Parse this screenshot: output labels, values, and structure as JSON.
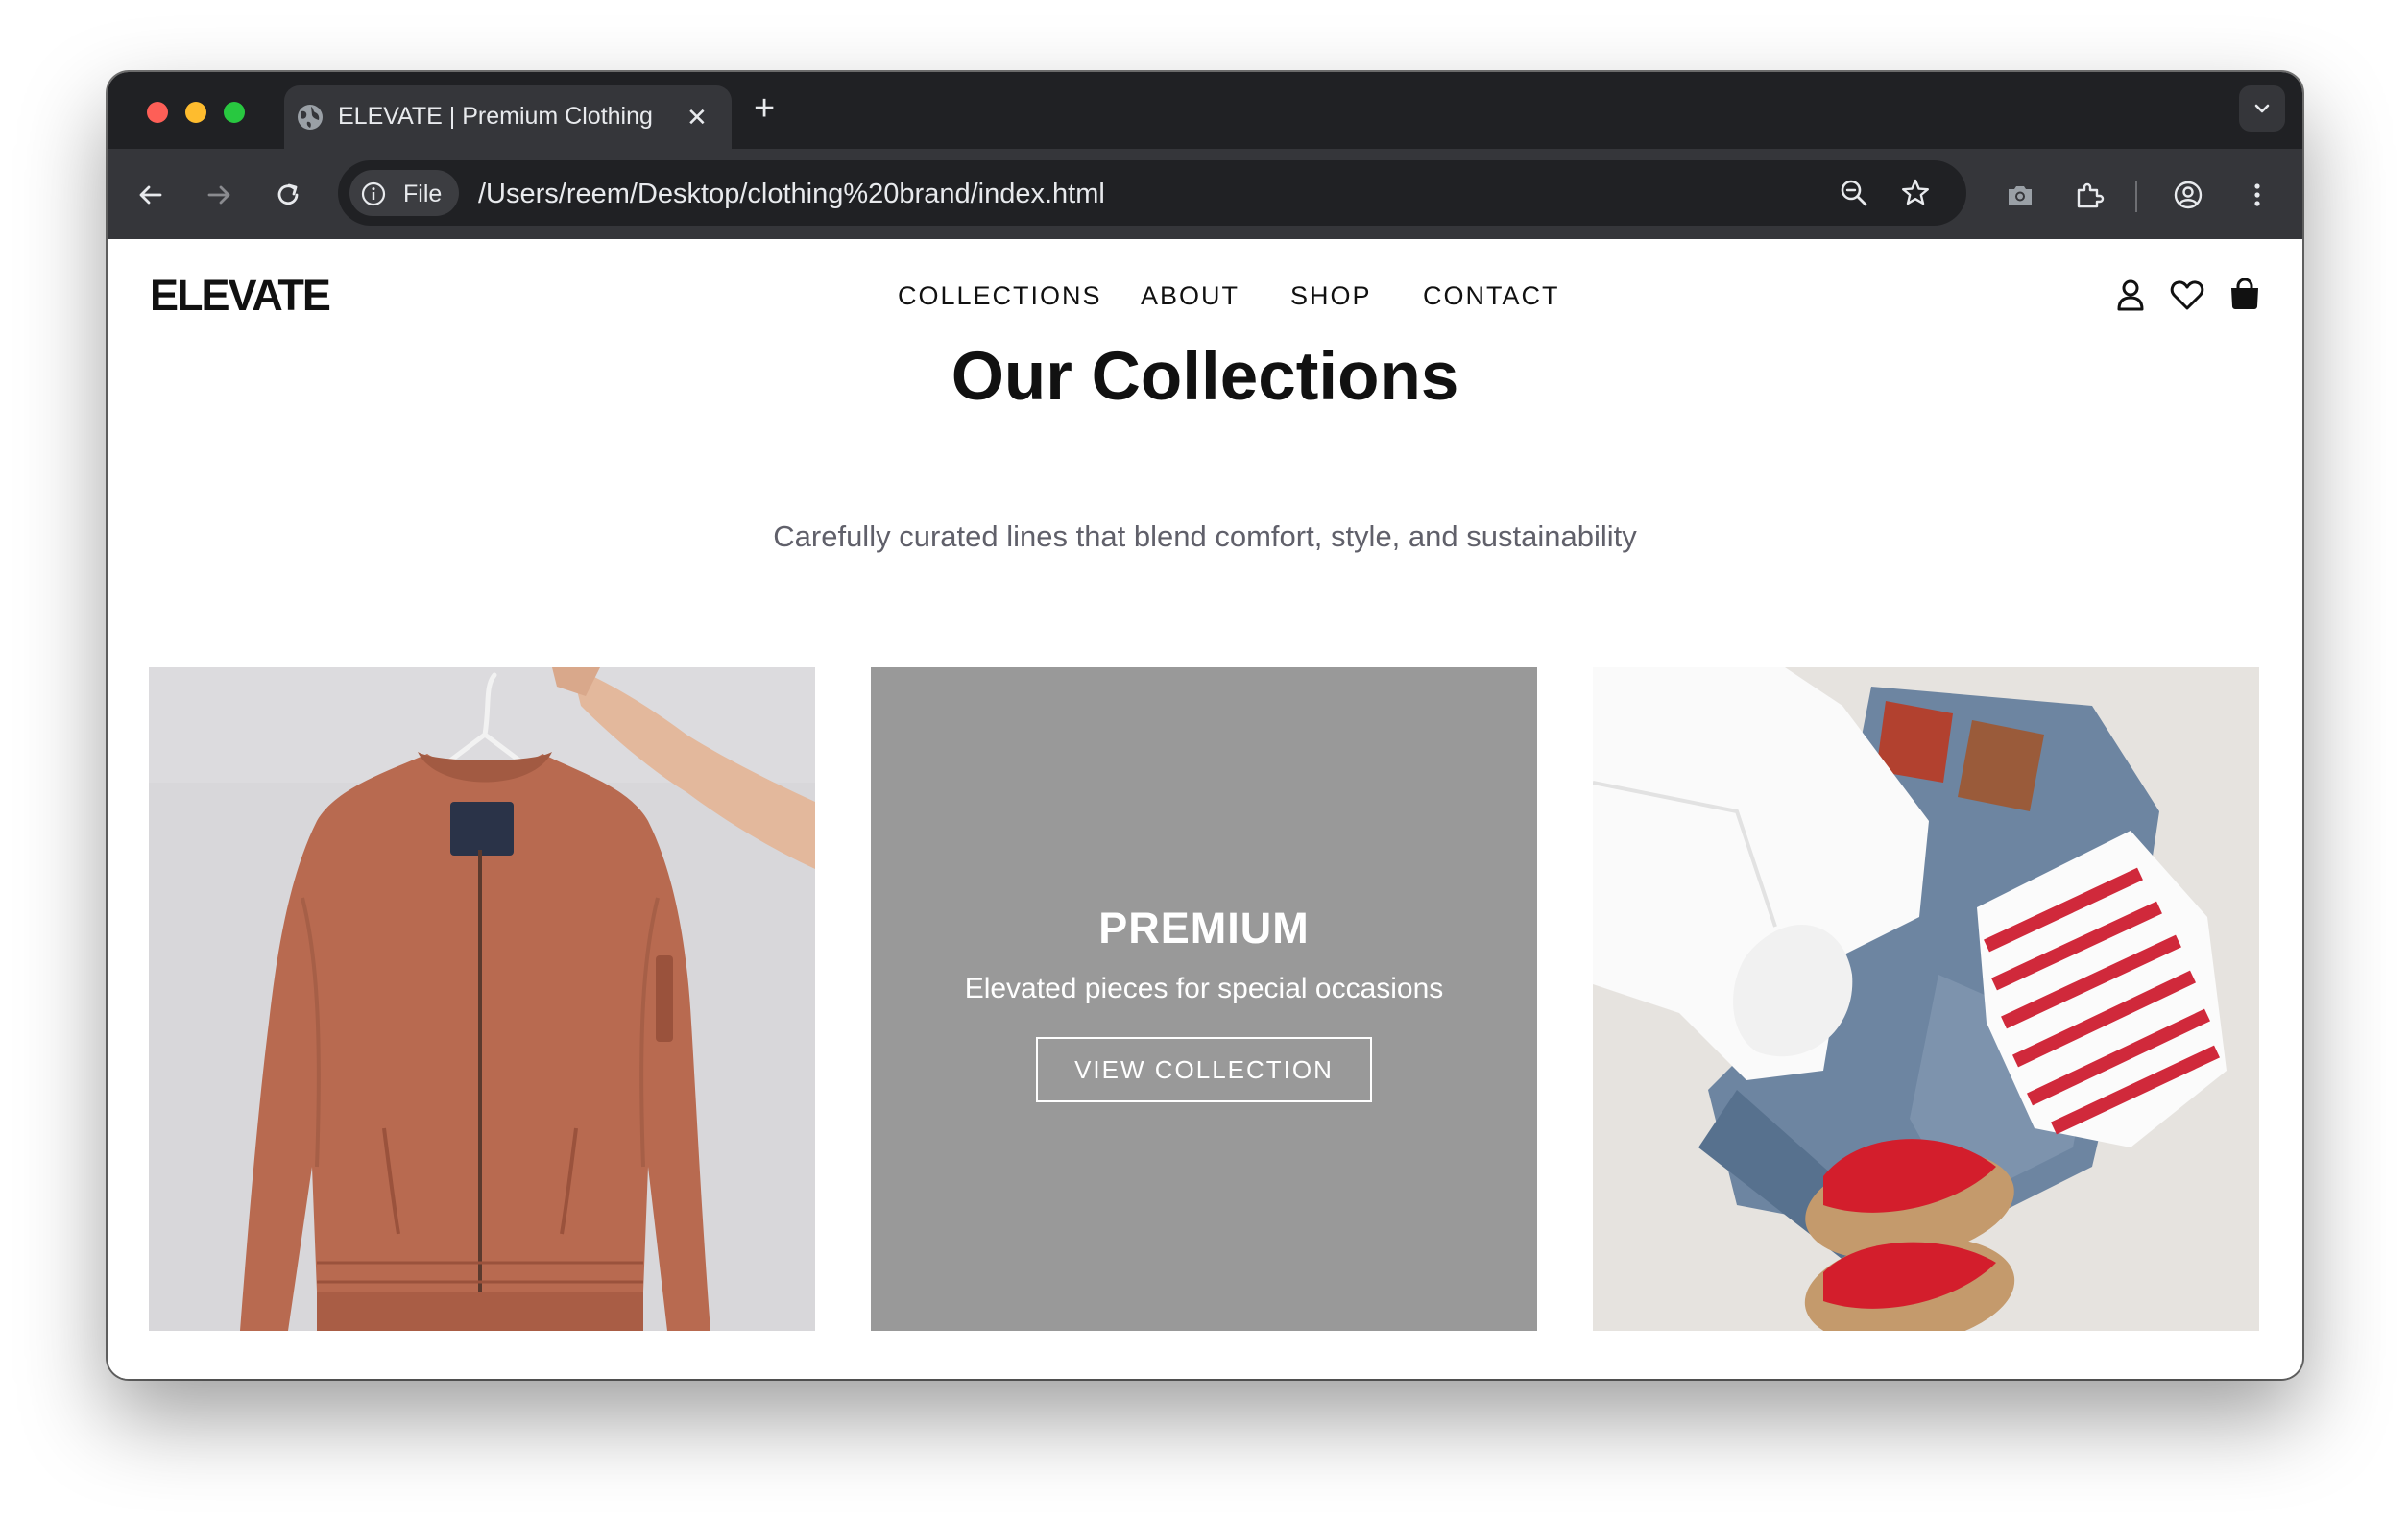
{
  "browser": {
    "tab_title": "ELEVATE | Premium Clothing",
    "tab_close": "✕",
    "new_tab": "+",
    "site_chip": "File",
    "url": "/Users/reem/Desktop/clothing%20brand/index.html",
    "icons": [
      "back-icon",
      "forward-icon",
      "reload-icon",
      "info-icon",
      "zoom-icon",
      "bookmark-star-icon",
      "camera-icon",
      "extensions-icon",
      "profile-icon",
      "more-icon",
      "tab-list-icon",
      "globe-icon"
    ]
  },
  "site": {
    "logo": "ELEVATE",
    "nav": {
      "collections": "COLLECTIONS",
      "about": "ABOUT",
      "shop": "SHOP",
      "contact": "CONTACT"
    },
    "header_icons": [
      "account-icon",
      "wishlist-heart-icon",
      "shopping-bag-icon"
    ]
  },
  "collections": {
    "title": "Our Collections",
    "subtitle": "Carefully curated lines that blend comfort, style, and sustainability",
    "cards": [
      {
        "image": "rust bomber jacket on hanger"
      },
      {
        "title": "PREMIUM",
        "description": "Elevated pieces for special occasions",
        "button": "VIEW COLLECTION"
      },
      {
        "image": "flat lay of white shirt, jeans, striped top and red sandals"
      }
    ]
  },
  "colors": {
    "page_bg": "#ffffff",
    "text": "#111111",
    "subtitle": "#60606a",
    "premium_card_bg": "#999999",
    "chrome_dark": "#202124",
    "chrome_toolbar": "#35363a",
    "jacket": "#b86a50"
  }
}
